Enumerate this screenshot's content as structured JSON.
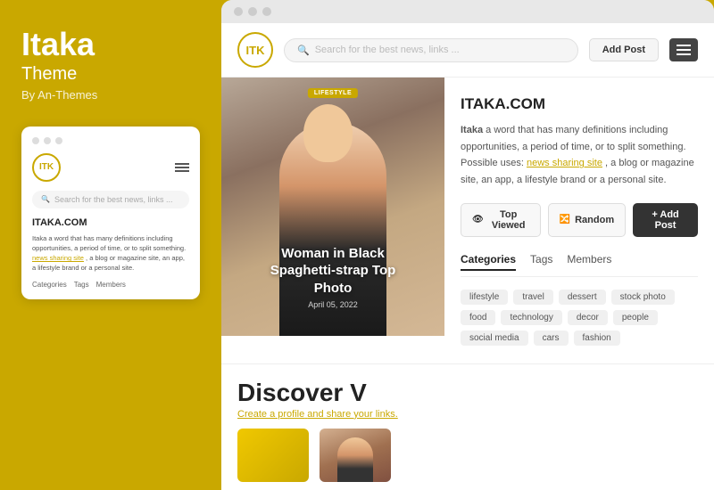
{
  "brand": {
    "title": "Itaka",
    "subtitle": "Theme",
    "by": "By An-Themes"
  },
  "mini_preview": {
    "logo_text": "ITK",
    "search_placeholder": "Search for the best news, links ...",
    "site_title": "ITAKA.COM",
    "desc_text": "Itaka a word that has many definitions including opportunities, a period of time, or to split something.",
    "desc_link": "news sharing site",
    "desc_suffix": ", a blog or magazine site, an app, a lifestyle brand or a personal site.",
    "tabs": [
      "Categories",
      "Tags",
      "Members"
    ]
  },
  "browser": {
    "dots": [
      "",
      "",
      ""
    ]
  },
  "site_header": {
    "logo_text": "ITK",
    "search_placeholder": "Search for the best news, links ...",
    "add_post_label": "Add Post"
  },
  "hero": {
    "badge": "LIFESTYLE",
    "title": "Woman in Black\nSpaghetti-strap Top\nPhoto",
    "date": "April 05, 2022"
  },
  "sidebar": {
    "site_title": "ITAKA.COM",
    "desc_intro": "Itaka",
    "desc_main": " a word that has many definitions including opportunities, a period of time, or to split something. Possible uses: ",
    "desc_link": "news sharing site",
    "desc_suffix": ", a blog or magazine site, an app, a lifestyle brand or a personal site.",
    "actions": {
      "top_viewed": "Top Viewed",
      "random": "Random",
      "add_post": "+ Add Post"
    },
    "tabs": [
      {
        "label": "Categories",
        "active": true
      },
      {
        "label": "Tags",
        "active": false
      },
      {
        "label": "Members",
        "active": false
      }
    ],
    "tags": [
      "lifestyle",
      "travel",
      "dessert",
      "stock photo",
      "food",
      "technology",
      "decor",
      "people",
      "social media",
      "cars",
      "fashion"
    ]
  },
  "discover": {
    "title": "Discover V",
    "subtitle_link": "Create a profile",
    "subtitle_suffix": " and share your links."
  }
}
